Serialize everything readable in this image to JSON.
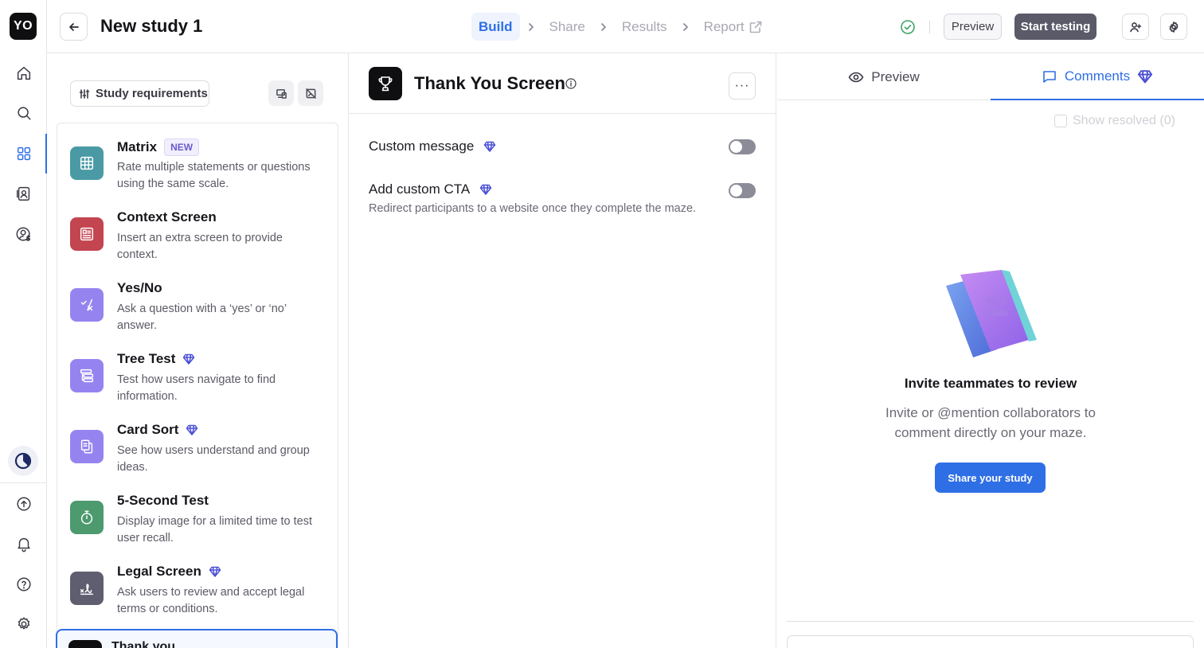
{
  "app": {
    "logo_text": "YO"
  },
  "rail": {
    "items": [
      {
        "icon": "home-icon"
      },
      {
        "icon": "search-icon"
      },
      {
        "icon": "grid-icon",
        "active": true
      },
      {
        "icon": "contacts-icon"
      },
      {
        "icon": "user-billing-icon"
      },
      {
        "icon": "usage-icon"
      },
      {
        "icon": "upload-icon"
      },
      {
        "icon": "bell-icon"
      },
      {
        "icon": "help-icon"
      },
      {
        "icon": "gear-icon"
      }
    ]
  },
  "header": {
    "title": "New study 1",
    "steps": [
      {
        "label": "Build",
        "current": true
      },
      {
        "label": "Share"
      },
      {
        "label": "Results"
      },
      {
        "label": "Report"
      }
    ],
    "preview_label": "Preview",
    "start_label": "Start testing"
  },
  "blocks": {
    "requirements_label": "Study requirements",
    "items": [
      {
        "title": "Matrix",
        "badge": "NEW",
        "desc": "Rate multiple statements or questions using the same scale.",
        "color": "#4a9aa5",
        "icon": "table-icon"
      },
      {
        "title": "Context Screen",
        "desc": "Insert an extra screen to provide context.",
        "color": "#c3454f",
        "icon": "document-icon"
      },
      {
        "title": "Yes/No",
        "desc": "Ask a question with a ‘yes’ or ‘no’ answer.",
        "color": "#9584f0",
        "icon": "yes-no-icon"
      },
      {
        "title": "Tree Test",
        "premium": true,
        "desc": "Test how users navigate to find information.",
        "color": "#9584f0",
        "icon": "tree-icon"
      },
      {
        "title": "Card Sort",
        "premium": true,
        "desc": "See how users understand and group ideas.",
        "color": "#9584f0",
        "icon": "cards-icon"
      },
      {
        "title": "5-Second Test",
        "desc": "Display image for a limited time to test user recall.",
        "color": "#4c9a6e",
        "icon": "timer-icon"
      },
      {
        "title": "Legal Screen",
        "premium": true,
        "desc": "Ask users to review and accept legal terms or conditions.",
        "color": "#5e5e70",
        "icon": "signature-icon"
      }
    ],
    "selected_label": "Thank you"
  },
  "editor": {
    "title": "Thank You Screen",
    "more_label": "···",
    "options": [
      {
        "label": "Custom message"
      },
      {
        "label": "Add custom CTA",
        "desc": "Redirect participants to a website once they complete the maze."
      }
    ]
  },
  "comments": {
    "tabs": [
      {
        "label": "Preview"
      },
      {
        "label": "Comments"
      }
    ],
    "show_resolved": "Show resolved (0)",
    "empty_title": "Invite teammates to review",
    "empty_desc": "Invite or @mention collaborators to comment directly on your maze.",
    "share_label": "Share your study"
  },
  "colors": {
    "accent": "#2f6fe6",
    "premium": "#4b4fd6",
    "start_button": "#5a5a69"
  }
}
